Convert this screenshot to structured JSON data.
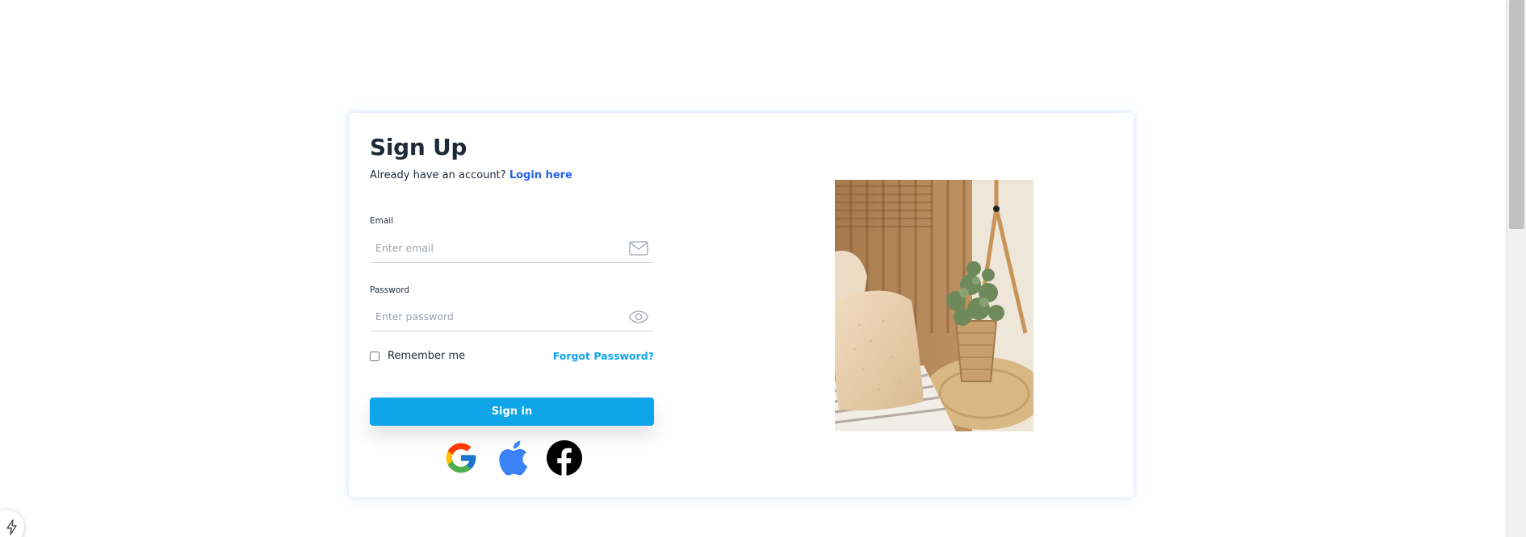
{
  "header": {
    "title": "Sign Up",
    "subtitle_text": "Already have an account?",
    "login_link": "Login here"
  },
  "form": {
    "email": {
      "label": "Email",
      "placeholder": "Enter email",
      "value": "",
      "icon": "envelope-icon"
    },
    "password": {
      "label": "Password",
      "placeholder": "Enter password",
      "value": "",
      "icon": "eye-icon"
    },
    "remember_label": "Remember me",
    "remember_checked": false,
    "forgot_label": "Forgot Password?",
    "submit_label": "Sign in"
  },
  "social_logins": [
    {
      "name": "google",
      "icon": "google-icon"
    },
    {
      "name": "apple",
      "icon": "apple-icon"
    },
    {
      "name": "facebook",
      "icon": "facebook-icon"
    }
  ],
  "image": {
    "description_icon": "interior-photo"
  },
  "colors": {
    "accent": "#0ea5e9",
    "link": "#2563eb",
    "title": "#1f2937",
    "border": "#d1d5db"
  }
}
